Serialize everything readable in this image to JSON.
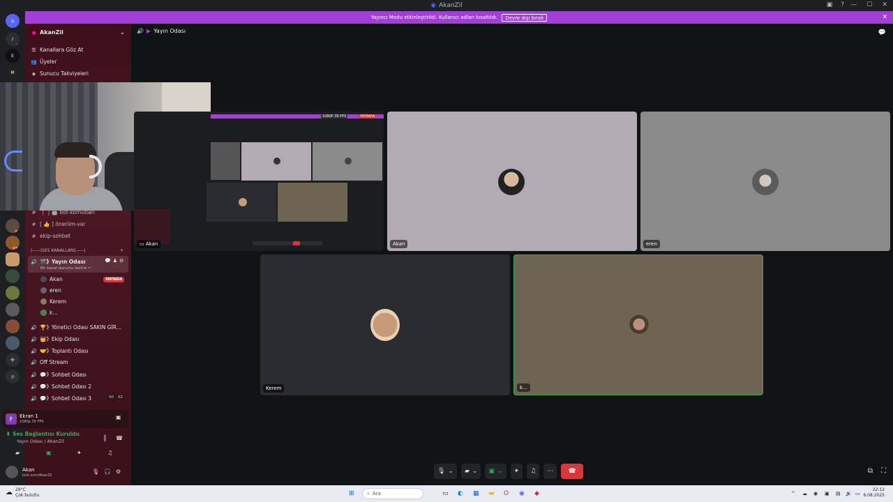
{
  "window": {
    "title": "AkanZil"
  },
  "notice": {
    "text": "Yayıncı Modu etkinleştirildi. Kullanıcı adları kısaltıldı.",
    "button": "Devre dışı bırak"
  },
  "server": {
    "name": "AkanZil"
  },
  "sidebar": {
    "top_items": [
      {
        "icon": "browse-icon",
        "label": "Kanallara Göz At"
      },
      {
        "icon": "members-icon",
        "label": "Üyeler"
      },
      {
        "icon": "boost-icon",
        "label": "Sunucu Takviyeleri"
      }
    ],
    "text_channels": [
      {
        "label": "❗ | 🤖 bot-komutları"
      },
      {
        "label": "[ 👍 ] öneriim-var"
      },
      {
        "label": "ekip-sohbet"
      }
    ],
    "voice_category": "|——|SES KANALLARI|——|",
    "active_channel": {
      "label": "🎬》Yayın Odası",
      "status": "Bir kanal durumu belirle ✏",
      "members": [
        {
          "name": "Akan",
          "live": "YAYINDA"
        },
        {
          "name": "eren"
        },
        {
          "name": "Kerem"
        },
        {
          "name": "k..."
        }
      ]
    },
    "voice_channels": [
      {
        "label": "🏆》Yönetici Odası SAKIN GİR..."
      },
      {
        "label": "👑》Ekip Odası"
      },
      {
        "label": "🤝》Toplantı Odası"
      },
      {
        "label": "Off Stream"
      },
      {
        "label": "💬》Sohbet Odası"
      },
      {
        "label": "💬》Sohbet Odası 2"
      },
      {
        "label": "💬》Sohbet Odası 3",
        "count_a": "00",
        "count_b": "02"
      }
    ]
  },
  "stream_panel": {
    "title": "Ekran 1",
    "subtitle": "1080p 30 FPS"
  },
  "voice_panel": {
    "status": "Ses Bağlantısı Kuruldu",
    "location": "Yayın Odası / AkanZil"
  },
  "user_panel": {
    "name": "Akan",
    "status": "kick.com/AkanZil"
  },
  "main": {
    "channel_title": "Yayın Odası",
    "tiles": [
      {
        "name": "Akan",
        "type": "stream",
        "badge": "1080P 30 FPS",
        "live": "YAYINDA"
      },
      {
        "name": "Akan"
      },
      {
        "name": "eren"
      },
      {
        "name": "Kerem"
      },
      {
        "name": "k..."
      }
    ]
  },
  "taskbar": {
    "weather_temp": "29°C",
    "weather_desc": "Çok bulutlu",
    "search_placeholder": "Ara",
    "time": "22:12",
    "date": "6.08.2025"
  },
  "colors": {
    "accent": "#a23fd6",
    "live": "#da373c",
    "speaking": "#3ba55d",
    "sidebar": "#4a1624"
  }
}
